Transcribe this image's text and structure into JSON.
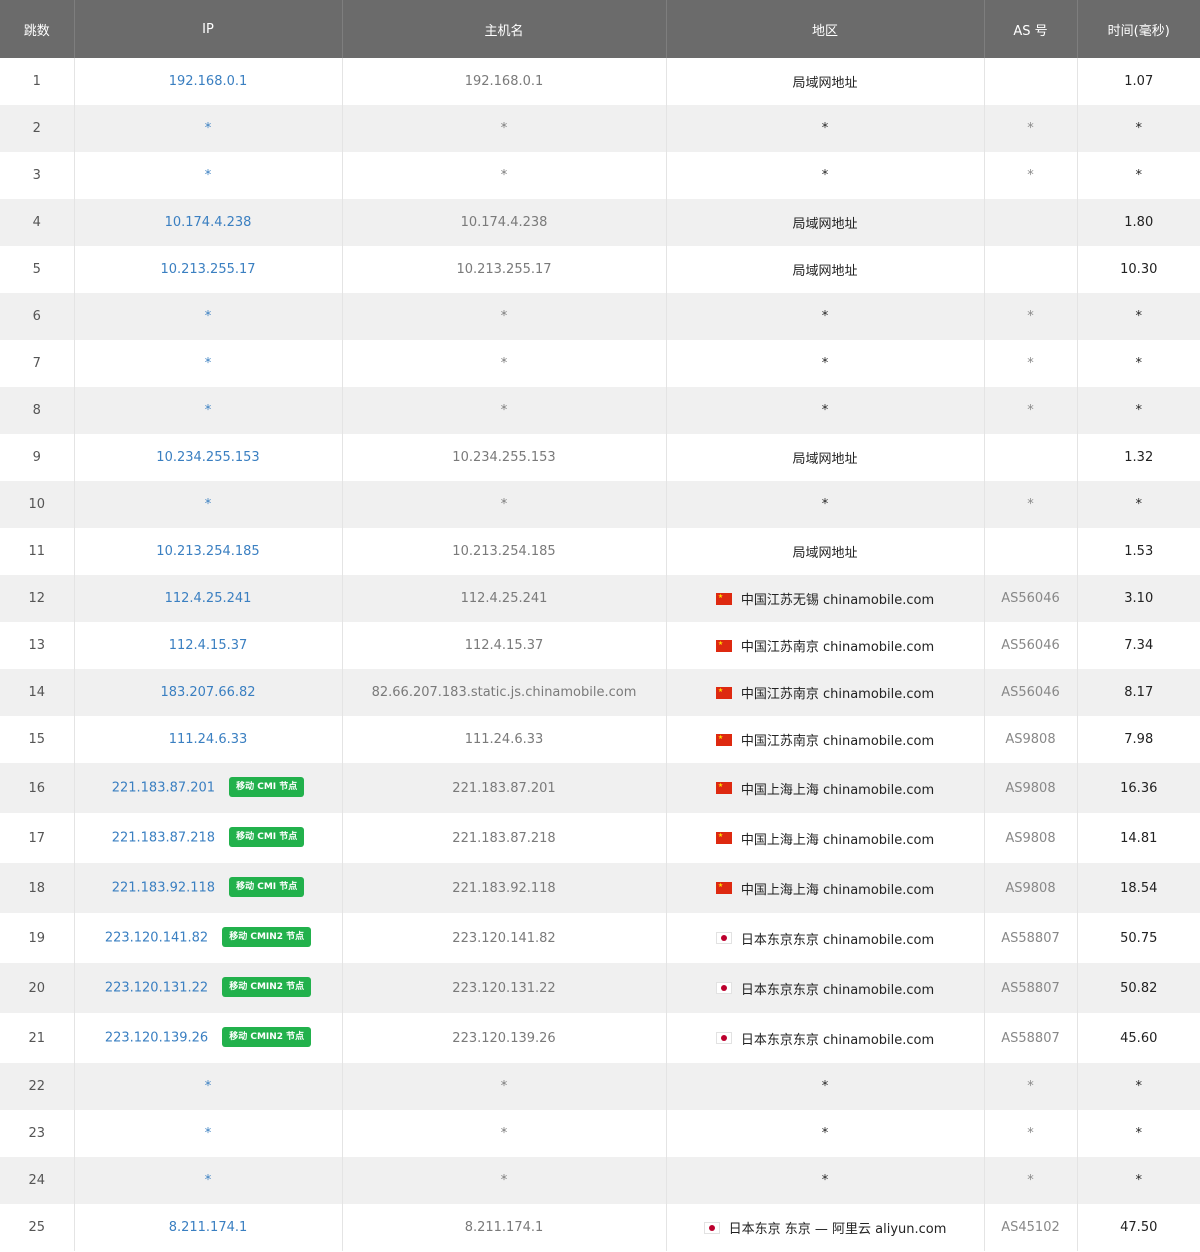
{
  "columns": {
    "hop": "跳数",
    "ip": "IP",
    "host": "主机名",
    "region": "地区",
    "as": "AS 号",
    "time": "时间(毫秒)"
  },
  "rows": [
    {
      "hop": "1",
      "ip": "192.168.0.1",
      "tag": "",
      "host": "192.168.0.1",
      "flag": "",
      "region": "局域网地址",
      "as": "",
      "time": "1.07"
    },
    {
      "hop": "2",
      "ip": "*",
      "tag": "",
      "host": "*",
      "flag": "",
      "region": "*",
      "as": "*",
      "time": "*"
    },
    {
      "hop": "3",
      "ip": "*",
      "tag": "",
      "host": "*",
      "flag": "",
      "region": "*",
      "as": "*",
      "time": "*"
    },
    {
      "hop": "4",
      "ip": "10.174.4.238",
      "tag": "",
      "host": "10.174.4.238",
      "flag": "",
      "region": "局域网地址",
      "as": "",
      "time": "1.80"
    },
    {
      "hop": "5",
      "ip": "10.213.255.17",
      "tag": "",
      "host": "10.213.255.17",
      "flag": "",
      "region": "局域网地址",
      "as": "",
      "time": "10.30"
    },
    {
      "hop": "6",
      "ip": "*",
      "tag": "",
      "host": "*",
      "flag": "",
      "region": "*",
      "as": "*",
      "time": "*"
    },
    {
      "hop": "7",
      "ip": "*",
      "tag": "",
      "host": "*",
      "flag": "",
      "region": "*",
      "as": "*",
      "time": "*"
    },
    {
      "hop": "8",
      "ip": "*",
      "tag": "",
      "host": "*",
      "flag": "",
      "region": "*",
      "as": "*",
      "time": "*"
    },
    {
      "hop": "9",
      "ip": "10.234.255.153",
      "tag": "",
      "host": "10.234.255.153",
      "flag": "",
      "region": "局域网地址",
      "as": "",
      "time": "1.32"
    },
    {
      "hop": "10",
      "ip": "*",
      "tag": "",
      "host": "*",
      "flag": "",
      "region": "*",
      "as": "*",
      "time": "*"
    },
    {
      "hop": "11",
      "ip": "10.213.254.185",
      "tag": "",
      "host": "10.213.254.185",
      "flag": "",
      "region": "局域网地址",
      "as": "",
      "time": "1.53"
    },
    {
      "hop": "12",
      "ip": "112.4.25.241",
      "tag": "",
      "host": "112.4.25.241",
      "flag": "cn",
      "region": "中国江苏无锡 chinamobile.com",
      "as": "AS56046",
      "time": "3.10"
    },
    {
      "hop": "13",
      "ip": "112.4.15.37",
      "tag": "",
      "host": "112.4.15.37",
      "flag": "cn",
      "region": "中国江苏南京 chinamobile.com",
      "as": "AS56046",
      "time": "7.34"
    },
    {
      "hop": "14",
      "ip": "183.207.66.82",
      "tag": "",
      "host": "82.66.207.183.static.js.chinamobile.com",
      "flag": "cn",
      "region": "中国江苏南京 chinamobile.com",
      "as": "AS56046",
      "time": "8.17"
    },
    {
      "hop": "15",
      "ip": "111.24.6.33",
      "tag": "",
      "host": "111.24.6.33",
      "flag": "cn",
      "region": "中国江苏南京 chinamobile.com",
      "as": "AS9808",
      "time": "7.98"
    },
    {
      "hop": "16",
      "ip": "221.183.87.201",
      "tag": "移动 CMI 节点",
      "host": "221.183.87.201",
      "flag": "cn",
      "region": "中国上海上海 chinamobile.com",
      "as": "AS9808",
      "time": "16.36"
    },
    {
      "hop": "17",
      "ip": "221.183.87.218",
      "tag": "移动 CMI 节点",
      "host": "221.183.87.218",
      "flag": "cn",
      "region": "中国上海上海 chinamobile.com",
      "as": "AS9808",
      "time": "14.81"
    },
    {
      "hop": "18",
      "ip": "221.183.92.118",
      "tag": "移动 CMI 节点",
      "host": "221.183.92.118",
      "flag": "cn",
      "region": "中国上海上海 chinamobile.com",
      "as": "AS9808",
      "time": "18.54"
    },
    {
      "hop": "19",
      "ip": "223.120.141.82",
      "tag": "移动 CMIN2 节点",
      "host": "223.120.141.82",
      "flag": "jp",
      "region": "日本东京东京 chinamobile.com",
      "as": "AS58807",
      "time": "50.75"
    },
    {
      "hop": "20",
      "ip": "223.120.131.22",
      "tag": "移动 CMIN2 节点",
      "host": "223.120.131.22",
      "flag": "jp",
      "region": "日本东京东京 chinamobile.com",
      "as": "AS58807",
      "time": "50.82"
    },
    {
      "hop": "21",
      "ip": "223.120.139.26",
      "tag": "移动 CMIN2 节点",
      "host": "223.120.139.26",
      "flag": "jp",
      "region": "日本东京东京 chinamobile.com",
      "as": "AS58807",
      "time": "45.60"
    },
    {
      "hop": "22",
      "ip": "*",
      "tag": "",
      "host": "*",
      "flag": "",
      "region": "*",
      "as": "*",
      "time": "*"
    },
    {
      "hop": "23",
      "ip": "*",
      "tag": "",
      "host": "*",
      "flag": "",
      "region": "*",
      "as": "*",
      "time": "*"
    },
    {
      "hop": "24",
      "ip": "*",
      "tag": "",
      "host": "*",
      "flag": "",
      "region": "*",
      "as": "*",
      "time": "*"
    },
    {
      "hop": "25",
      "ip": "8.211.174.1",
      "tag": "",
      "host": "8.211.174.1",
      "flag": "jp",
      "region": "日本东京 东京 — 阿里云 aliyun.com",
      "as": "AS45102",
      "time": "47.50"
    }
  ],
  "colors": {
    "header_bg": "#6b6b6b",
    "ip_link": "#3a7fc1",
    "tag_bg": "#22b14c",
    "row_alt": "#f0f0f0"
  }
}
